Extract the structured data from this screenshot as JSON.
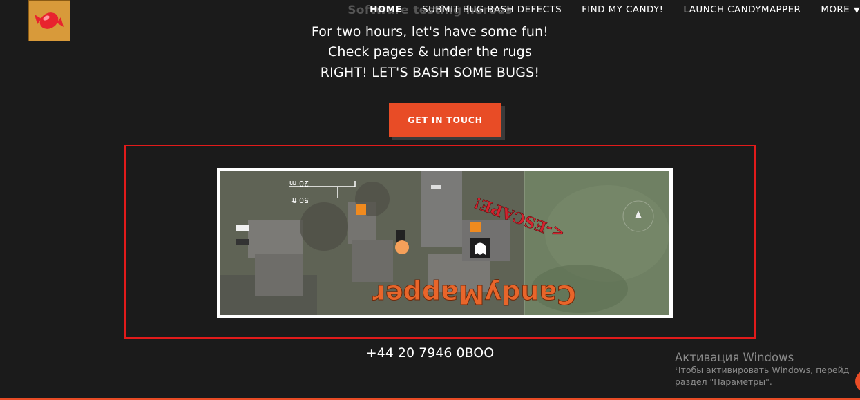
{
  "header": {
    "logo_icon": "candy-logo-icon",
    "heading_partial": "Software testing heroes"
  },
  "nav": {
    "items": [
      {
        "label": "HOME",
        "active": true
      },
      {
        "label": "SUBMIT BUG BASH DEFECTS"
      },
      {
        "label": "FIND MY CANDY!"
      },
      {
        "label": "LAUNCH CANDYMAPPER"
      },
      {
        "label": "MORE",
        "icon": "chevron-down-icon"
      }
    ]
  },
  "hero": {
    "lines": [
      "For two hours, let's have some fun!",
      "Check pages & under the rugs",
      "RIGHT! LET'S BASH SOME BUGS!"
    ],
    "cta_label": "GET IN TOUCH"
  },
  "map": {
    "title_text": "CandyMapper",
    "escape_text": "<-ESCAPE!",
    "scale_ft": "50 ft",
    "scale_m": "20 m",
    "highlight_color": "#e21b1b",
    "accent_color": "#e84c26"
  },
  "contact": {
    "phone": "+44 20 7946 0BOO"
  },
  "os_watermark": {
    "title": "Активация Windows",
    "line1": "Чтобы активировать Windows, перейд",
    "line2": "раздел \"Параметры\"."
  }
}
